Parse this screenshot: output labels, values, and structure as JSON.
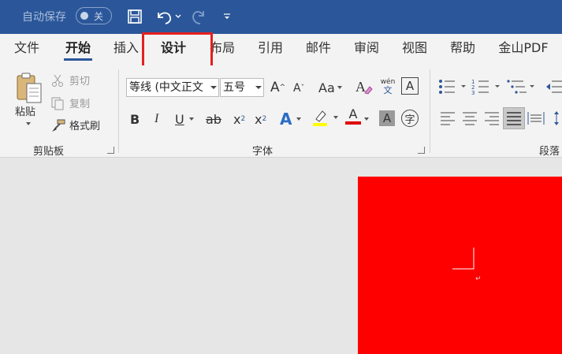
{
  "titlebar": {
    "autosave_label": "自动保存",
    "autosave_state": "关",
    "icons": [
      "save-icon",
      "undo-icon",
      "redo-icon",
      "customize-quick-access-icon"
    ]
  },
  "tabs": [
    {
      "label": "文件",
      "active": false
    },
    {
      "label": "开始",
      "active": true
    },
    {
      "label": "插入",
      "active": false
    },
    {
      "label": "设计",
      "active": false,
      "highlighted": true
    },
    {
      "label": "布局",
      "active": false
    },
    {
      "label": "引用",
      "active": false
    },
    {
      "label": "邮件",
      "active": false
    },
    {
      "label": "审阅",
      "active": false
    },
    {
      "label": "视图",
      "active": false
    },
    {
      "label": "帮助",
      "active": false
    },
    {
      "label": "金山PDF",
      "active": false
    }
  ],
  "clipboard": {
    "paste_label": "粘贴",
    "cut_label": "剪切",
    "copy_label": "复制",
    "format_painter_label": "格式刷",
    "group_label": "剪贴板"
  },
  "font": {
    "font_name": "等线 (中文正文",
    "font_size": "五号",
    "grow_label": "A",
    "shrink_label": "A",
    "case_label": "Aa",
    "phonetic_top": "wén",
    "phonetic_bottom": "文",
    "border_char_label": "A",
    "bold_label": "B",
    "italic_label": "I",
    "underline_label": "U",
    "strike_label": "ab",
    "subscript_label": "x",
    "subscript_sub": "2",
    "superscript_label": "x",
    "superscript_sup": "2",
    "effects_label": "A",
    "color_label": "A",
    "shading_label": "A",
    "enclose_label": "字",
    "group_label": "字体",
    "highlight_color": "#ffff00",
    "font_color": "#e00000"
  },
  "paragraph": {
    "group_label": "段落"
  },
  "document": {
    "page_color": "#ff0000"
  }
}
